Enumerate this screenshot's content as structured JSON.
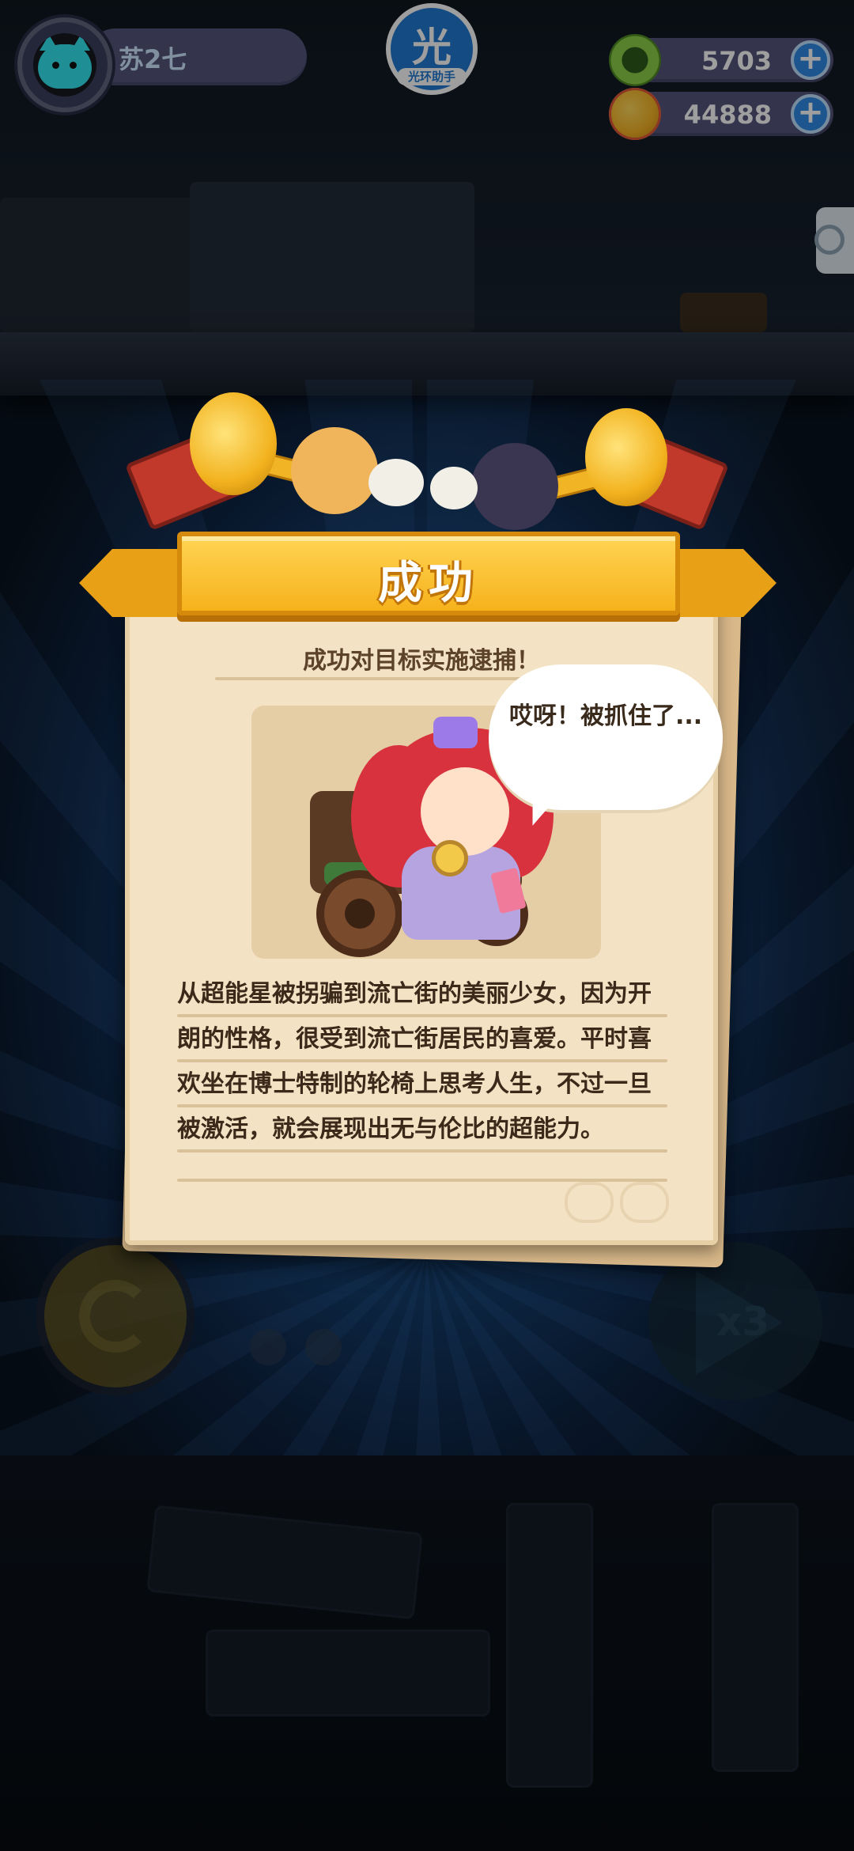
{
  "player": {
    "name": "苏2七",
    "avatar_icon": "cyan-cat-avatar-icon"
  },
  "assistant": {
    "big_char": "光",
    "label": "光环助手"
  },
  "currencies": [
    {
      "name": "donut",
      "value": "5703",
      "color": "#8ed04a"
    },
    {
      "name": "planet",
      "value": "44888",
      "color": "#f5b325"
    }
  ],
  "plus_symbol": "+",
  "result": {
    "banner": "成功",
    "subtitle": "成功对目标实施逮捕！",
    "speech": "哎呀！被抓住了...",
    "description": [
      "从超能星被拐骗到流亡街的美丽少女，因为开",
      "朗的性格，很受到流亡街居民的喜爱。平时喜",
      "欢坐在博士特制的轮椅上思考人生，不过一旦",
      "被激活，就会展现出无与伦比的超能力。"
    ]
  },
  "controls": {
    "speed_label": "x3"
  },
  "colors": {
    "accent_gold": "#f6b21c",
    "parchment": "#f3e3c4",
    "plus_blue": "#2f89e6"
  }
}
